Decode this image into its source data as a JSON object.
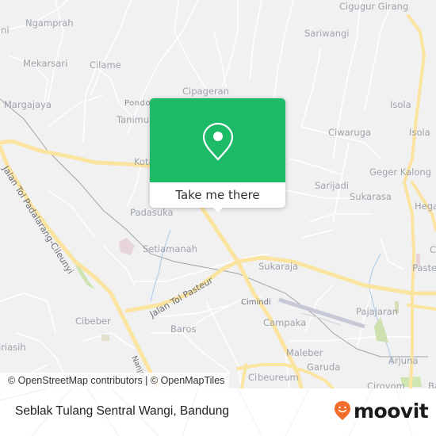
{
  "map": {
    "places": [
      {
        "id": "ngamprah",
        "label": "Ngamprah"
      },
      {
        "id": "ani",
        "label": "ani"
      },
      {
        "id": "mekarsari",
        "label": "Mekarsari"
      },
      {
        "id": "cilame",
        "label": "Cilame"
      },
      {
        "id": "margajaya",
        "label": "Margajaya"
      },
      {
        "id": "pondok",
        "label": "Pondo"
      },
      {
        "id": "tanimulya",
        "label": "Tanimul"
      },
      {
        "id": "cipageran",
        "label": "Cipageran"
      },
      {
        "id": "cigugur-girang",
        "label": "Cigugur Girang"
      },
      {
        "id": "sariwangi",
        "label": "Sariwangi"
      },
      {
        "id": "isola-1",
        "label": "Isola"
      },
      {
        "id": "isola-2",
        "label": "Isola"
      },
      {
        "id": "ciwaruga",
        "label": "Ciwaruga"
      },
      {
        "id": "geger-kalong",
        "label": "Geger Kalong"
      },
      {
        "id": "sarijadi",
        "label": "Sarijadi"
      },
      {
        "id": "sukarasa",
        "label": "Sukarasa"
      },
      {
        "id": "hegarmanah",
        "label": "Hega"
      },
      {
        "id": "kota",
        "label": "Kota"
      },
      {
        "id": "padasuka",
        "label": "Padasuka"
      },
      {
        "id": "setiamanah",
        "label": "Setiamanah"
      },
      {
        "id": "sukaraja",
        "label": "Sukaraja"
      },
      {
        "id": "cimindi",
        "label": "Cimindi"
      },
      {
        "id": "campaka",
        "label": "Campaka"
      },
      {
        "id": "pajajaran",
        "label": "Pajajaran"
      },
      {
        "id": "pasteur",
        "label": "Paste"
      },
      {
        "id": "ci-right",
        "label": "Ci"
      },
      {
        "id": "cibeber",
        "label": "Cibeber"
      },
      {
        "id": "baros",
        "label": "Baros"
      },
      {
        "id": "maleber",
        "label": "Maleber"
      },
      {
        "id": "garuda",
        "label": "Garuda"
      },
      {
        "id": "arjuna",
        "label": "Arjuna"
      },
      {
        "id": "ciroyom",
        "label": "Ciroyom"
      },
      {
        "id": "cibeureum",
        "label": "beureum"
      },
      {
        "id": "cibeureum-pre",
        "label": "Ci"
      },
      {
        "id": "giriasih",
        "label": "iriasih"
      },
      {
        "id": "ba",
        "label": "Ba"
      }
    ],
    "roads": [
      {
        "id": "tol-padalarang",
        "label": "Jalan Tol Padalarang-Cileunyi"
      },
      {
        "id": "tol-pasteur",
        "label": "Jalan Tol Pasteur"
      },
      {
        "id": "nanjung",
        "label": "Nanjung"
      }
    ],
    "attribution": "© OpenStreetMap contributors | © OpenMapTiles"
  },
  "popup": {
    "icon": "map-pin-icon",
    "cta_label": "Take me there",
    "color": "#1dba68"
  },
  "footer": {
    "title": "Seblak Tulang Sentral Wangi, Bandung",
    "brand": "moovit",
    "brand_color": "#f26c2b"
  }
}
